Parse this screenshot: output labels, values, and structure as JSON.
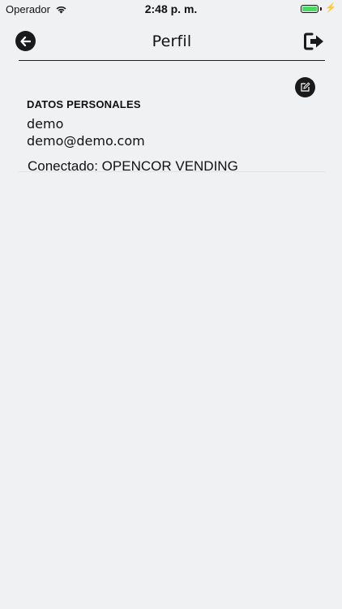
{
  "status_bar": {
    "carrier": "Operador",
    "time": "2:48 p. m.",
    "battery_level": 1.0,
    "battery_color": "#4cd964"
  },
  "header": {
    "title": "Perfil",
    "back_icon": "arrow-left-icon",
    "logout_icon": "sign-out-icon"
  },
  "profile": {
    "edit_icon": "edit-icon",
    "section_title": "DATOS PERSONALES",
    "name": "demo",
    "email": "demo@demo.com",
    "connected": "Conectado: OPENCOR VENDING"
  }
}
